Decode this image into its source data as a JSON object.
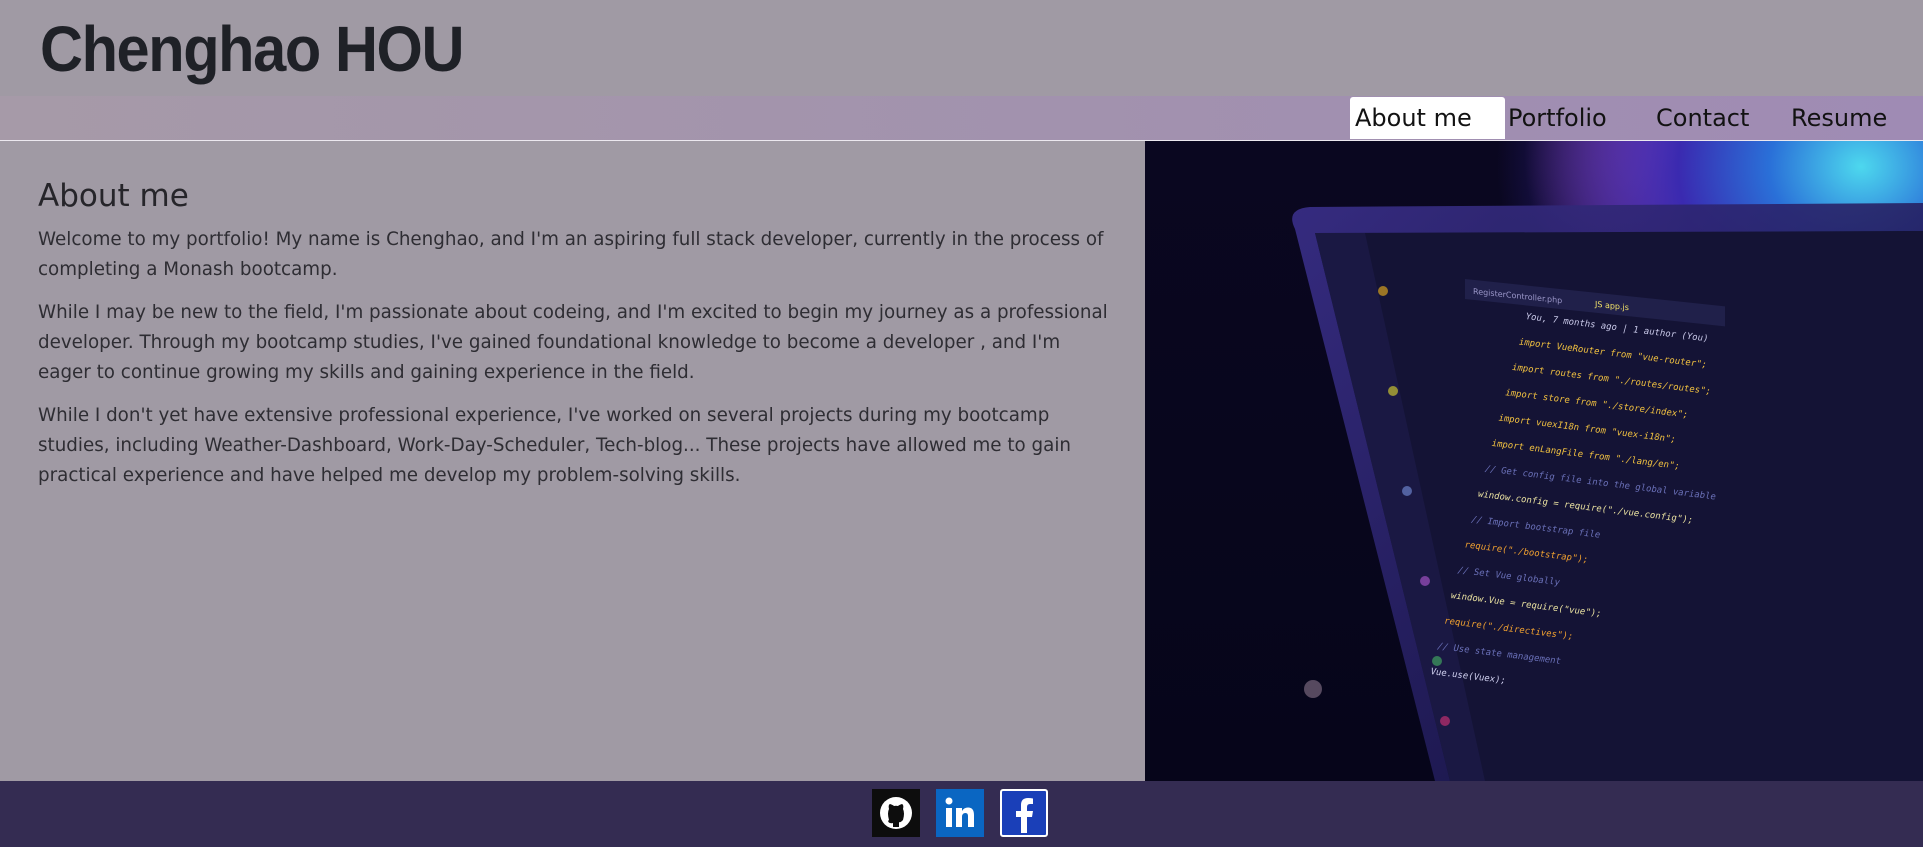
{
  "header": {
    "title": "Chenghao HOU"
  },
  "nav": {
    "items": [
      {
        "label": "About me",
        "active": true
      },
      {
        "label": "Portfolio",
        "active": false
      },
      {
        "label": "Contact",
        "active": false
      },
      {
        "label": "Resume",
        "active": false
      }
    ]
  },
  "about": {
    "heading": "About me",
    "paragraphs": [
      "Welcome to my portfolio! My name is Chenghao, and I'm an aspiring full stack developer, currently in the process of completing a Monash bootcamp.",
      "While I may be new to the field, I'm passionate about codeing, and I'm excited to begin my journey as a professional developer. Through my bootcamp studies, I've gained foundational knowledge to become a developer , and I'm eager to continue growing my skills and gaining experience in the field.",
      "While I don't yet have extensive professional experience, I've worked on several projects during my bootcamp studies, including Weather-Dashboard, Work-Day-Scheduler, Tech-blog... These projects have allowed me to gain practical experience and have helped me develop my problem-solving skills."
    ]
  },
  "hero_image": {
    "code_lines": [
      "You, 7 months ago | 1 author (You)",
      "import VueRouter from \"vue-router\";",
      "import routes from \"./routes/routes\";",
      "import store from \"./store/index\";",
      "import vuexI18n from \"vuex-i18n\";",
      "import enLangFile from \"./lang/en\";",
      "// Get config file into the global variable",
      "window.config = require(\"./vue.config\");",
      "// Import bootstrap file",
      "require(\"./bootstrap\");",
      "// Set Vue globally",
      "window.Vue = require(\"vue\");",
      "require(\"./directives\");",
      "// Use state management",
      "Vue.use(Vuex);"
    ],
    "tabs": [
      "RegisterController.php",
      "JS app.js"
    ]
  },
  "footer": {
    "links": [
      {
        "icon": "github-icon",
        "name": "GitHub",
        "bg": "#0d0d0d"
      },
      {
        "icon": "linkedin-icon",
        "name": "LinkedIn",
        "bg": "#0a66c2"
      },
      {
        "icon": "facebook-icon",
        "name": "Facebook",
        "bg": "#1877f2"
      }
    ]
  },
  "colors": {
    "page_bg": "#a09aa4",
    "nav_active_bg": "#ffffff",
    "footer_bg": "#342c52",
    "text": "#2e2d33"
  }
}
